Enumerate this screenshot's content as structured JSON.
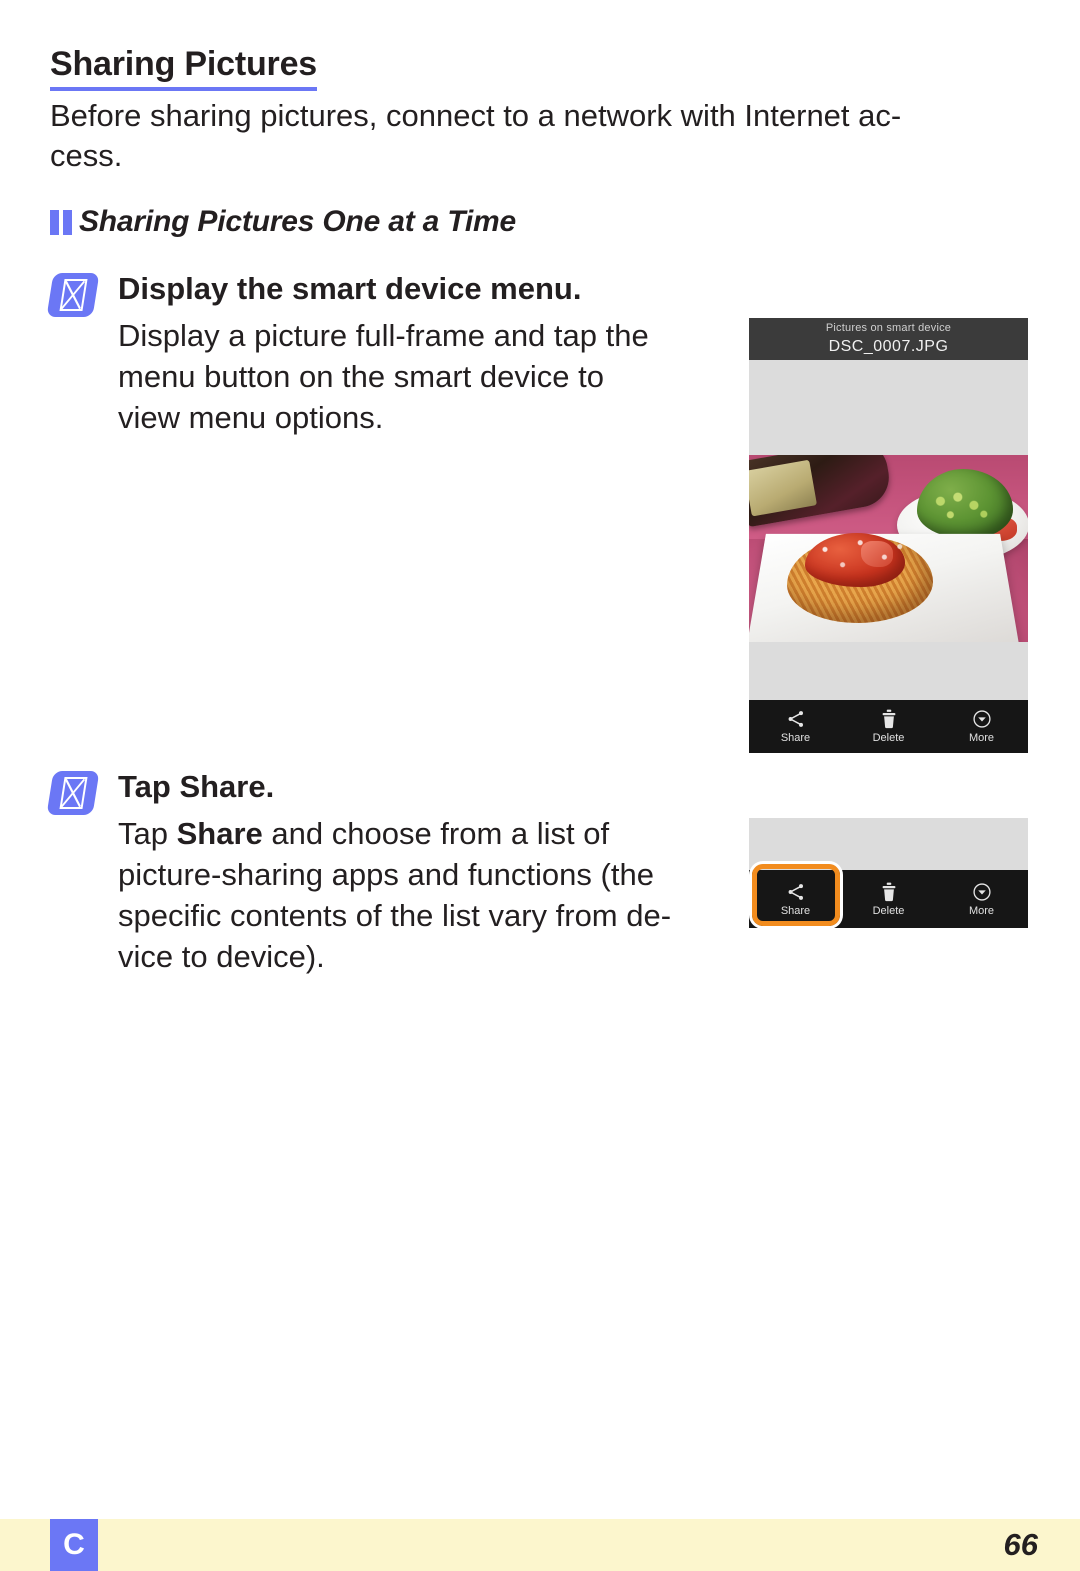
{
  "document": {
    "section_heading": "Sharing Pictures",
    "intro_line1": "Before sharing pictures, connect to a network with Internet ac-",
    "intro_line2": "cess.",
    "subheading": "Sharing Pictures One at a Time"
  },
  "steps": [
    {
      "badge_glyph": "missing-glyph-box",
      "title": "Display the smart device menu.",
      "body_line1": "Display a picture full-frame and tap the",
      "body_line2": "menu  button  on  the  smart  device  to",
      "body_line3": "view menu options."
    },
    {
      "badge_glyph": "missing-glyph-box",
      "title_prefix": "Tap ",
      "title_bold": "Share",
      "title_suffix": ".",
      "body_line1_a": "Tap ",
      "body_line1_b": "Share",
      "body_line1_c": " and  choose  from  a  list  of",
      "body_line2": "picture-sharing apps and functions (the",
      "body_line3": "specific contents of the list vary from de-",
      "body_line4": "vice to device)."
    }
  ],
  "device_figure": {
    "header_caption": "Pictures on smart device",
    "header_filename": "DSC_0007.JPG",
    "photo_description": "spaghetti with tomato sauce on white plate, green salad and wine bottle on pink tablecloth",
    "toolbar": [
      {
        "icon": "share-icon",
        "label": "Share"
      },
      {
        "icon": "trash-icon",
        "label": "Delete"
      },
      {
        "icon": "more-circle-chevron-icon",
        "label": "More"
      }
    ]
  },
  "device_figure_2": {
    "toolbar": [
      {
        "icon": "share-icon",
        "label": "Share"
      },
      {
        "icon": "trash-icon",
        "label": "Delete"
      },
      {
        "icon": "more-circle-chevron-icon",
        "label": "More"
      }
    ],
    "highlight_target": "Share"
  },
  "footer": {
    "chapter_letter": "C",
    "page_number": "66"
  },
  "colors": {
    "accent_blue": "#6B77F5",
    "highlight_orange": "#F28C1E",
    "footer_band": "#FCF6CD",
    "device_gray": "#dcdcdc",
    "device_header": "#3b3b3b",
    "device_toolbar": "#161616",
    "text": "#231f20"
  }
}
